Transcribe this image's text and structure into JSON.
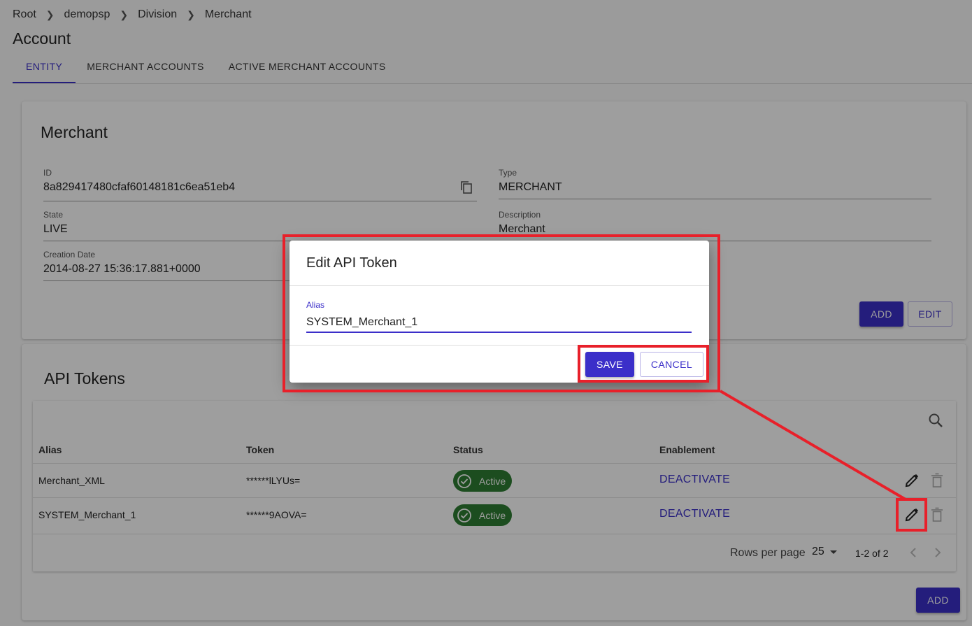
{
  "breadcrumb": [
    "Root",
    "demopsp",
    "Division",
    "Merchant"
  ],
  "page_title": "Account",
  "tabs": [
    {
      "label": "ENTITY",
      "active": true
    },
    {
      "label": "MERCHANT ACCOUNTS",
      "active": false
    },
    {
      "label": "ACTIVE MERCHANT ACCOUNTS",
      "active": false
    }
  ],
  "merchant_card": {
    "title": "Merchant",
    "fields": {
      "id": {
        "label": "ID",
        "value": "8a829417480cfaf60148181c6ea51eb4"
      },
      "type": {
        "label": "Type",
        "value": "MERCHANT"
      },
      "state": {
        "label": "State",
        "value": "LIVE"
      },
      "description": {
        "label": "Description",
        "value": "Merchant"
      },
      "creation_date": {
        "label": "Creation Date",
        "value": "2014-08-27 15:36:17.881+0000"
      }
    },
    "add_label": "ADD",
    "edit_label": "EDIT"
  },
  "api_card": {
    "title": "API Tokens",
    "columns": [
      "Alias",
      "Token",
      "Status",
      "Enablement"
    ],
    "rows": [
      {
        "alias": "Merchant_XML",
        "token": "******lLYUs=",
        "status": "Active",
        "enablement": "DEACTIVATE"
      },
      {
        "alias": "SYSTEM_Merchant_1",
        "token": "******9AOVA=",
        "status": "Active",
        "enablement": "DEACTIVATE"
      }
    ],
    "rows_per_page_label": "Rows per page",
    "rows_per_page_value": "25",
    "range": "1-2 of 2",
    "add_label": "ADD"
  },
  "dialog": {
    "title": "Edit API Token",
    "alias_label": "Alias",
    "alias_value": "SYSTEM_Merchant_1",
    "save_label": "SAVE",
    "cancel_label": "CANCEL"
  },
  "colors": {
    "accent": "#3b2fc9",
    "active_chip": "#2e7d32",
    "annotation": "#e8202a"
  },
  "icons": [
    "chevron-right-icon",
    "copy-icon",
    "search-icon",
    "check-circle-icon",
    "pencil-icon",
    "trash-icon",
    "caret-down-icon",
    "chevron-left-icon"
  ]
}
